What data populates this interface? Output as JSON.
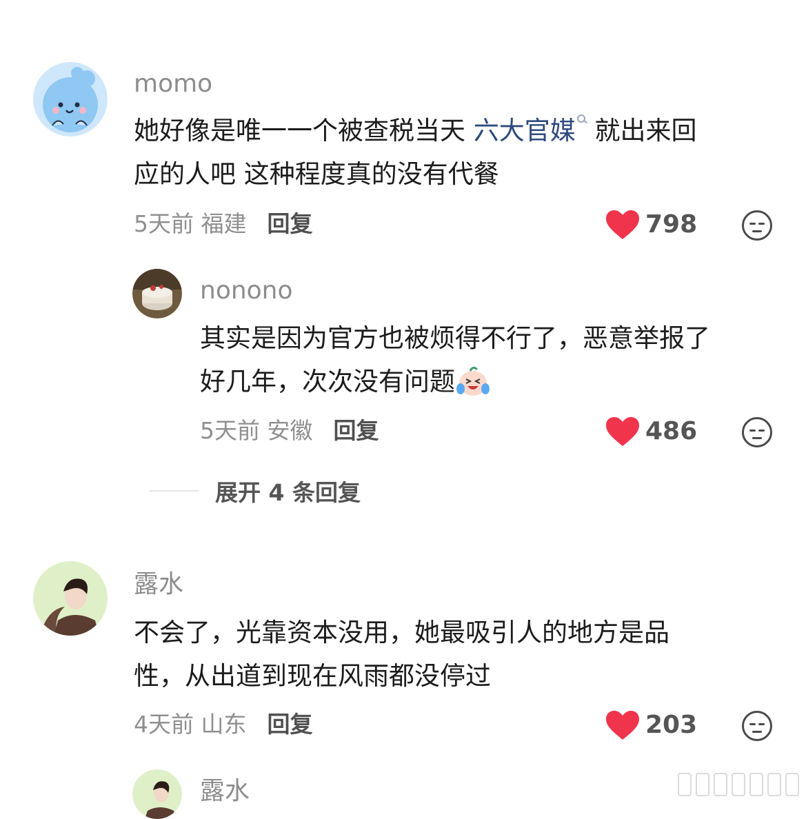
{
  "comments": [
    {
      "username": "momo",
      "text_line1_before": "她好像是唯一一个被查税当天 ",
      "text_link": "六大官媒",
      "text_line1_after": " 就出来回",
      "text_line2": "应的人吧 这种程度真的没有代餐",
      "meta": "5天前 福建",
      "reply_label": "回复",
      "likes": "798",
      "avatar_icon": "blue-cartoon-avatar"
    },
    {
      "username": "nonono",
      "text_line1": "其实是因为官方也被烦得不行了，恶意举报了",
      "text_line2": "好几年，次次没有问题",
      "emoji": "crying-laughing-emoji",
      "meta": "5天前 安徽",
      "reply_label": "回复",
      "likes": "486",
      "avatar_icon": "cake-photo-avatar"
    },
    {
      "expand_label": "展开 4 条回复"
    },
    {
      "username": "露水",
      "text_line1": "不会了，光靠资本没用，她最吸引人的地方是品",
      "text_line2": "性，从出道到现在风雨都没停过",
      "meta": "4天前 山东",
      "reply_label": "回复",
      "likes": "203",
      "avatar_icon": "woman-photo-avatar"
    },
    {
      "username": "露水",
      "avatar_icon": "woman-photo-avatar"
    }
  ],
  "colors": {
    "like_red": "#f0344c",
    "link_blue": "#2d4a7c",
    "meta_gray": "#8f8f8f"
  }
}
